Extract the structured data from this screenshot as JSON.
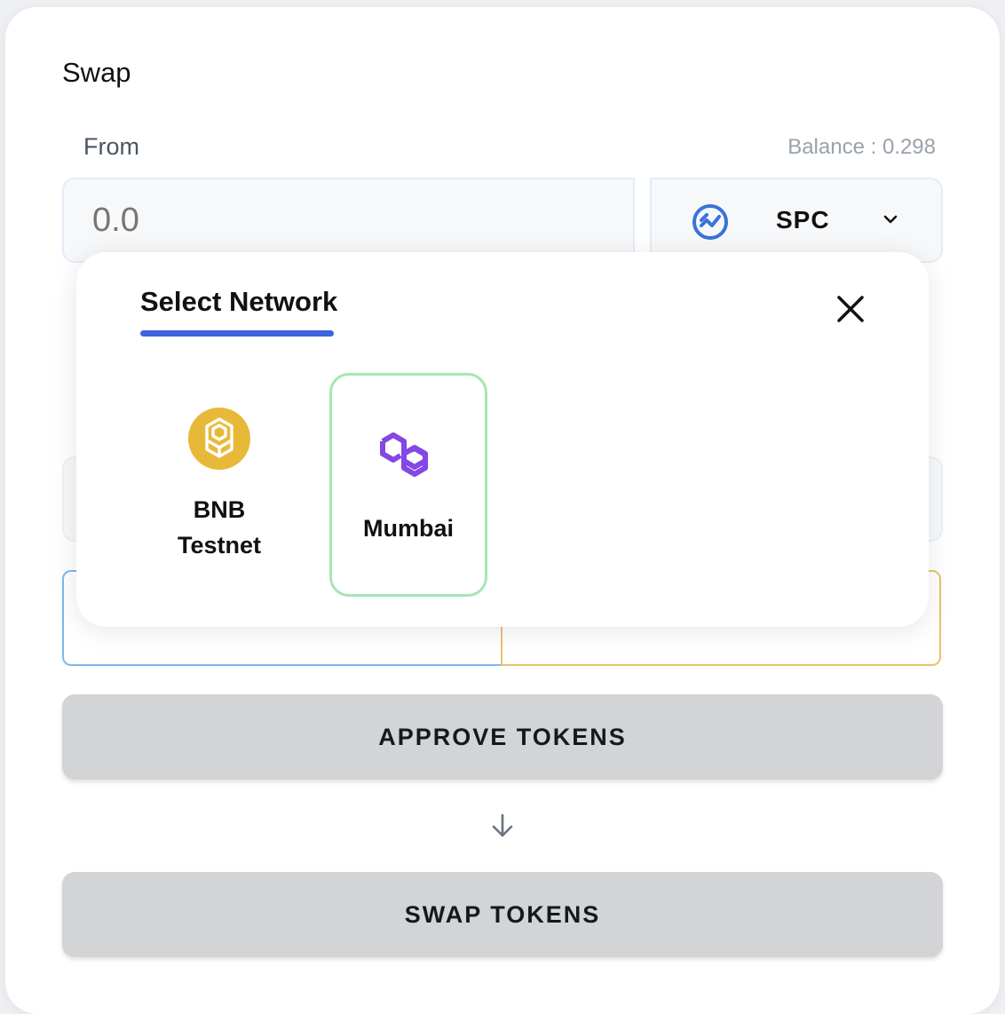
{
  "swap": {
    "title": "Swap",
    "from_label": "From",
    "from_balance": "Balance : 0.298",
    "amount_placeholder": "0.0",
    "from_token": {
      "symbol": "SPC",
      "icon": "spc-token-icon"
    },
    "approve_label": "APPROVE TOKENS",
    "swap_label": "SWAP TOKENS"
  },
  "modal": {
    "title": "Select Network",
    "close_icon": "close-icon",
    "networks": [
      {
        "name": "BNB\nTestnet",
        "icon": "bnb-icon",
        "selected": false
      },
      {
        "name": "Mumbai",
        "icon": "polygon-icon",
        "selected": true
      }
    ]
  },
  "colors": {
    "accent": "#3e63dd",
    "selected_border": "#a6e6b1",
    "bnb": "#e8b938",
    "polygon": "#8247e5",
    "button_bg": "#d3d4d6"
  }
}
